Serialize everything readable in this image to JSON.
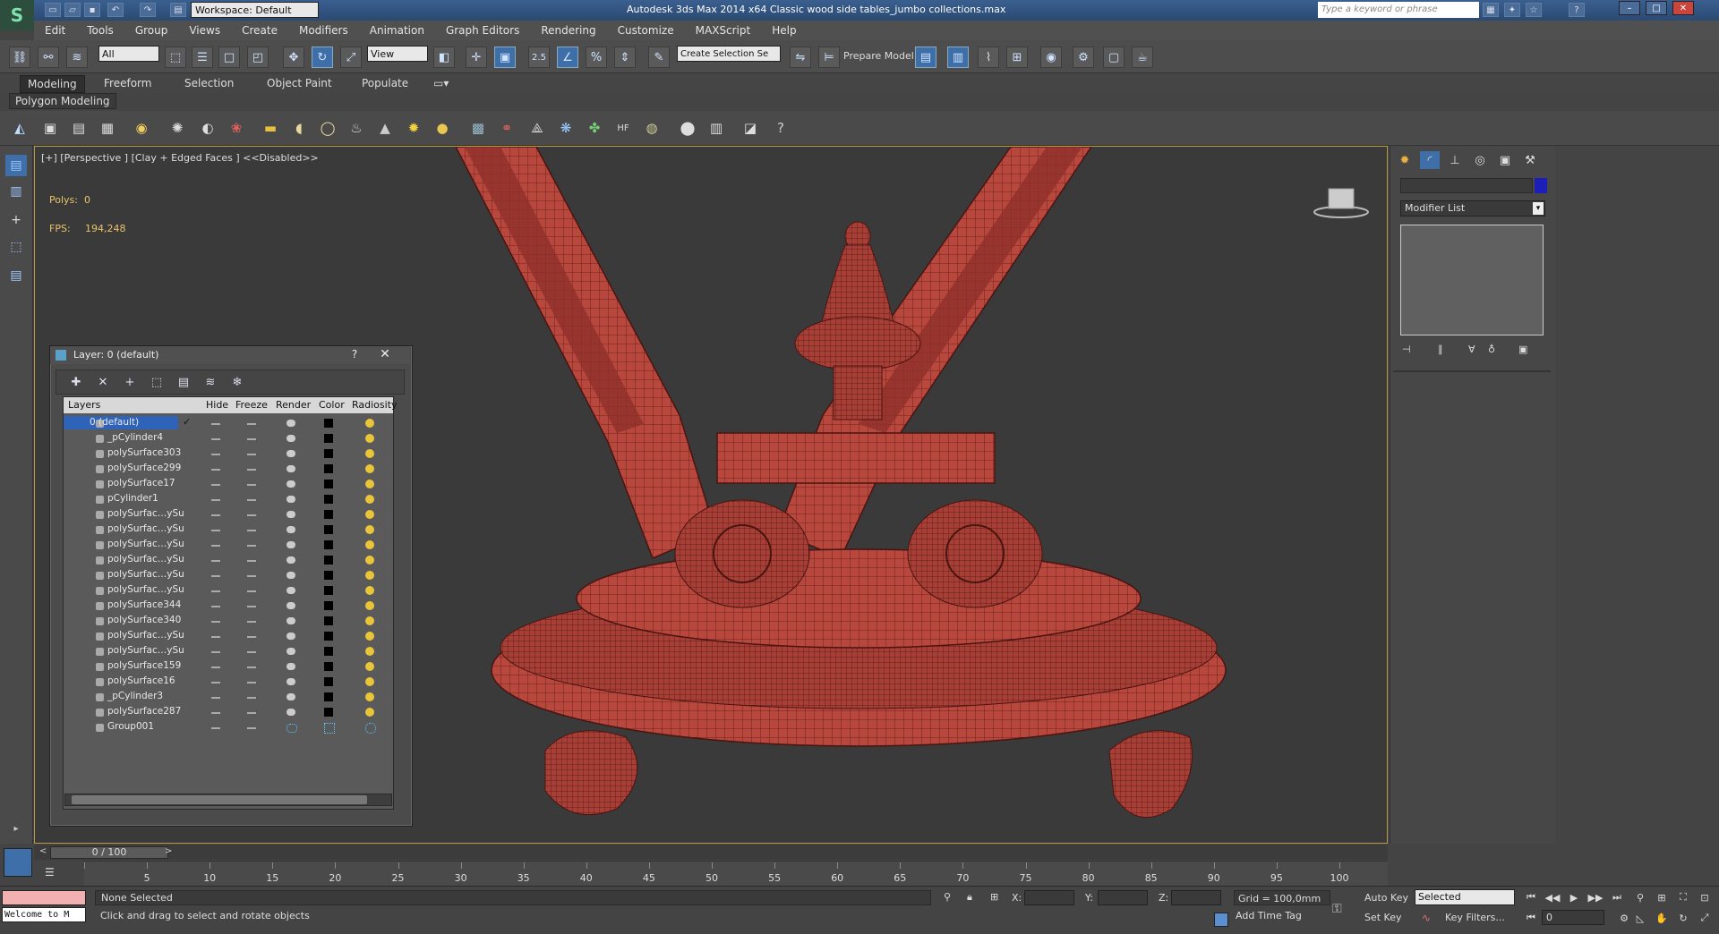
{
  "titlebar": {
    "workspace_label": "Workspace: Default",
    "title": "Autodesk 3ds Max  2014 x64      Classic wood side tables_jumbo collections.max",
    "search_placeholder": "Type a keyword or phrase"
  },
  "menubar": {
    "items": [
      "Edit",
      "Tools",
      "Group",
      "Views",
      "Create",
      "Modifiers",
      "Animation",
      "Graph Editors",
      "Rendering",
      "Customize",
      "MAXScript",
      "Help"
    ]
  },
  "toolbar": {
    "selection_filter": "All",
    "ref_coord": "View",
    "snap_value": "2.5",
    "named_selection": "Create Selection Se",
    "prepare_model": "Prepare Model"
  },
  "ribbon": {
    "tabs": [
      "Modeling",
      "Freeform",
      "Selection",
      "Object Paint",
      "Populate"
    ],
    "active_tab": "Modeling",
    "panel_label": "Polygon Modeling"
  },
  "viewport": {
    "label": "[+] [Perspective ] [Clay + Edged Faces ]  <<Disabled>>",
    "polys_label": "Polys:",
    "polys_value": "0",
    "fps_label": "FPS:",
    "fps_value": "194,248",
    "model_color": "#b8473d"
  },
  "command_panel": {
    "modifier_list": "Modifier List",
    "object_color": "#1d1db8"
  },
  "layer_window": {
    "title": "Layer: 0 (default)",
    "help": "?",
    "close": "✕",
    "columns": [
      "Layers",
      "Hide",
      "Freeze",
      "Render",
      "Color",
      "Radiosity"
    ],
    "rows": [
      {
        "name": "0 (default)"
      },
      {
        "name": "_pCylinder4"
      },
      {
        "name": "polySurface303"
      },
      {
        "name": "polySurface299"
      },
      {
        "name": "polySurface17"
      },
      {
        "name": "pCylinder1"
      },
      {
        "name": "polySurfac…ySu"
      },
      {
        "name": "polySurfac…ySu"
      },
      {
        "name": "polySurfac…ySu"
      },
      {
        "name": "polySurfac…ySu"
      },
      {
        "name": "polySurfac…ySu"
      },
      {
        "name": "polySurfac…ySu"
      },
      {
        "name": "polySurface344"
      },
      {
        "name": "polySurface340"
      },
      {
        "name": "polySurfac…ySu"
      },
      {
        "name": "polySurfac…ySu"
      },
      {
        "name": "polySurface159"
      },
      {
        "name": "polySurface16"
      },
      {
        "name": "_pCylinder3"
      },
      {
        "name": "polySurface287"
      },
      {
        "name": "Group001"
      }
    ]
  },
  "timeline": {
    "slider_text": "0 / 100",
    "ticks": [
      "5",
      "10",
      "15",
      "20",
      "25",
      "30",
      "35",
      "40",
      "45",
      "50",
      "55",
      "60",
      "65",
      "70",
      "75",
      "80",
      "85",
      "90",
      "95",
      "100"
    ]
  },
  "status": {
    "welcome": "Welcome to M",
    "selection": "None Selected",
    "prompt": "Click and drag to select and rotate objects",
    "x_label": "X:",
    "y_label": "Y:",
    "z_label": "Z:",
    "grid": "Grid = 100,0mm",
    "add_time_tag": "Add Time Tag",
    "auto_key": "Auto Key",
    "set_key": "Set Key",
    "key_mode": "Selected",
    "key_filters": "Key Filters...",
    "frame": "0"
  }
}
